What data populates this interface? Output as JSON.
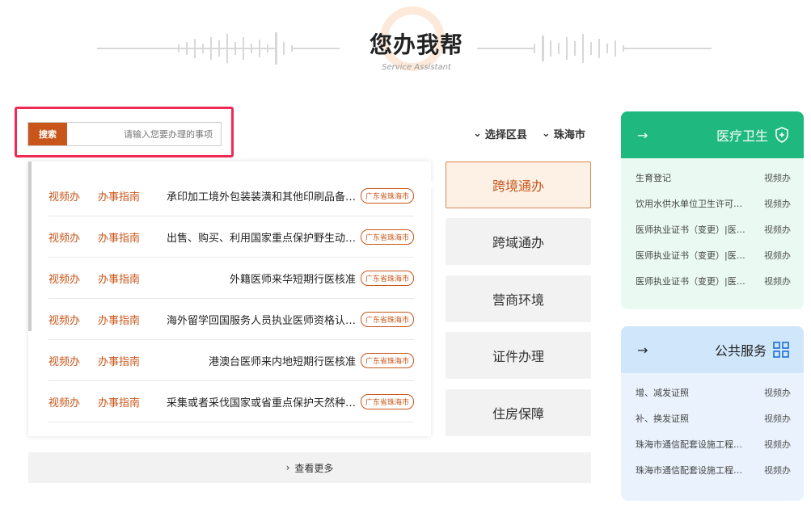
{
  "header": {
    "title": "您办我帮",
    "subtitle": "Service Assistant"
  },
  "search": {
    "button_label": "搜索",
    "placeholder": "请输入您要办理的事项"
  },
  "filters": {
    "region": "珠海市",
    "district": "选择区县"
  },
  "categories": [
    {
      "label": "跨境通办"
    },
    {
      "label": "跨域通办"
    },
    {
      "label": "营商环境"
    },
    {
      "label": "证件办理"
    },
    {
      "label": "住房保障"
    }
  ],
  "services": [
    {
      "name": "承印加工境外包装装潢和其他印刷品备…",
      "tag": "广东省珠海市",
      "guide": "办事指南",
      "video": "视频办"
    },
    {
      "name": "出售、购买、利用国家重点保护野生动…",
      "tag": "广东省珠海市",
      "guide": "办事指南",
      "video": "视频办"
    },
    {
      "name": "外籍医师来华短期行医核准",
      "tag": "广东省珠海市",
      "guide": "办事指南",
      "video": "视频办"
    },
    {
      "name": "海外留学回国服务人员执业医师资格认…",
      "tag": "广东省珠海市",
      "guide": "办事指南",
      "video": "视频办"
    },
    {
      "name": "港澳台医师来内地短期行医核准",
      "tag": "广东省珠海市",
      "guide": "办事指南",
      "video": "视频办"
    },
    {
      "name": "采集或者采伐国家或省重点保护天然种…",
      "tag": "广东省珠海市",
      "guide": "办事指南",
      "video": "视频办"
    }
  ],
  "more_label": "查看更多",
  "medical_panel": {
    "title": "医疗卫生",
    "items": [
      {
        "label": "生育登记",
        "action": "视频办"
      },
      {
        "label": "饮用水供水单位卫生许可…",
        "action": "视频办"
      },
      {
        "label": "医师执业证书（变更）|医…",
        "action": "视频办"
      },
      {
        "label": "医师执业证书（变更）|医…",
        "action": "视频办"
      },
      {
        "label": "医师执业证书（变更）|医…",
        "action": "视频办"
      }
    ]
  },
  "public_panel": {
    "title": "公共服务",
    "items": [
      {
        "label": "增、减发证照",
        "action": "视频办"
      },
      {
        "label": "补、换发证照",
        "action": "视频办"
      },
      {
        "label": "珠海市通信配套设施工程…",
        "action": "视频办"
      },
      {
        "label": "珠海市通信配套设施工程…",
        "action": "视频办"
      }
    ]
  },
  "colors": {
    "accent": "#c8561a",
    "highlight": "#ef2a55",
    "medical": "#1fb87e",
    "public": "#cfe6fb"
  }
}
